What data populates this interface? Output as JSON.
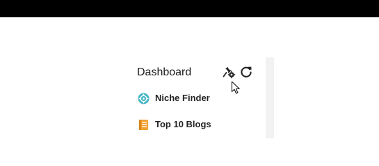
{
  "window": {
    "title_bar_color": "#000000"
  },
  "panel": {
    "title": "Dashboard",
    "actions": [
      {
        "icon": "pin-settings-icon"
      },
      {
        "icon": "refresh-icon"
      }
    ],
    "items": [
      {
        "label": "Niche Finder",
        "icon": "target-icon",
        "icon_color": "#45b6c4"
      },
      {
        "label": "Top 10 Blogs",
        "icon": "document-icon",
        "icon_color": "#f0a030"
      }
    ]
  },
  "colors": {
    "text": "#1a1a1a",
    "panel_edge": "#f2f2f2"
  }
}
